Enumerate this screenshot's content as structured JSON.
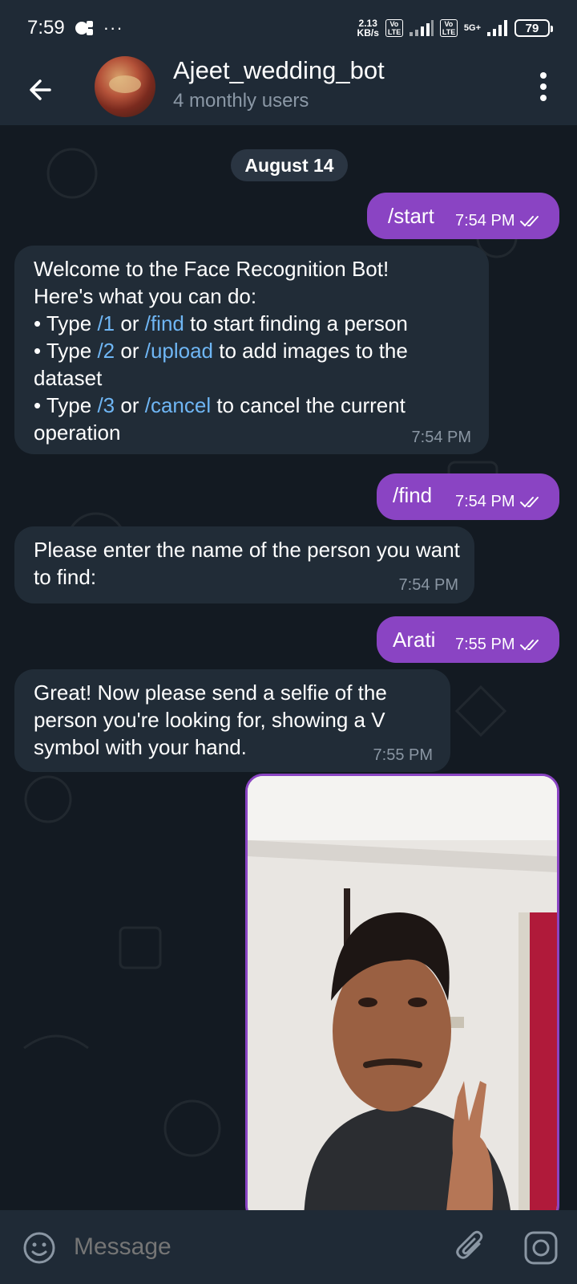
{
  "status_bar": {
    "time": "7:59",
    "dots": "···",
    "speed_value": "2.13",
    "speed_unit": "KB/s",
    "volte1": "Vo LTE",
    "volte2": "Vo LTE",
    "network": "5G+",
    "battery": "79"
  },
  "header": {
    "title": "Ajeet_wedding_bot",
    "subtitle": "4 monthly users"
  },
  "chat": {
    "date_label": "August 14",
    "messages": [
      {
        "direction": "out",
        "text": "/start",
        "time": "7:54 PM"
      },
      {
        "direction": "in",
        "line1": "Welcome to the Face Recognition Bot!",
        "line2": "Here's what you can do:",
        "b1_pre": "• Type ",
        "b1_cmd1": "/1",
        "b1_mid": " or ",
        "b1_cmd2": "/find",
        "b1_post": " to start finding a person",
        "b2_pre": "• Type ",
        "b2_cmd1": "/2",
        "b2_mid": " or ",
        "b2_cmd2": "/upload",
        "b2_post": " to add images to the dataset",
        "b3_pre": "• Type ",
        "b3_cmd1": "/3",
        "b3_mid": " or ",
        "b3_cmd2": "/cancel",
        "b3_post": " to cancel the current operation",
        "time": "7:54 PM"
      },
      {
        "direction": "out",
        "text": "/find",
        "time": "7:54 PM"
      },
      {
        "direction": "in",
        "text": "Please enter the name of the person you want to find:",
        "time": "7:54 PM"
      },
      {
        "direction": "out",
        "text": "Arati",
        "time": "7:55 PM"
      },
      {
        "direction": "in",
        "text": "Great! Now please send a selfie of the person you're looking for, showing a V symbol with your hand.",
        "time": "7:55 PM"
      },
      {
        "direction": "out",
        "type": "photo"
      }
    ]
  },
  "input_bar": {
    "placeholder": "Message"
  },
  "icons": {
    "back": "arrow-left-icon",
    "menu": "more-vertical-icon",
    "read": "double-check-icon",
    "emoji": "emoji-icon",
    "attach": "paperclip-icon",
    "camera": "camera-icon"
  },
  "colors": {
    "outgoing_bubble": "#8a44c3",
    "incoming_bubble": "#212c37",
    "link": "#6fb6f4",
    "background": "#131a22",
    "bar": "#1f2a36"
  }
}
